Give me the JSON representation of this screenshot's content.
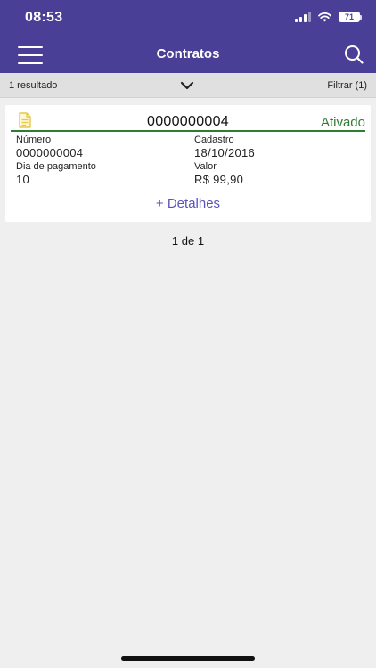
{
  "status_bar": {
    "time": "08:53",
    "battery": "71"
  },
  "header": {
    "title": "Contratos",
    "menu_icon": "hamburger-menu-icon",
    "search_icon": "search-icon"
  },
  "filter_bar": {
    "result_count": "1 resultado",
    "expand_icon": "chevron-down-icon",
    "filter_label": "Filtrar (1)"
  },
  "contracts": [
    {
      "icon": "document-icon",
      "id": "0000000004",
      "status": "Ativado",
      "fields": {
        "numero_label": "Número",
        "numero_value": "0000000004",
        "cadastro_label": "Cadastro",
        "cadastro_value": "18/10/2016",
        "dia_label": "Dia de pagamento",
        "dia_value": "10",
        "valor_label": "Valor",
        "valor_value": "R$ 99,90"
      },
      "details_link": "+ Detalhes"
    }
  ],
  "pagination": "1 de 1",
  "colors": {
    "primary": "#4a3f97",
    "status_active": "#2e7d32",
    "link": "#5b52b8",
    "document_icon": "#e6c84a"
  }
}
